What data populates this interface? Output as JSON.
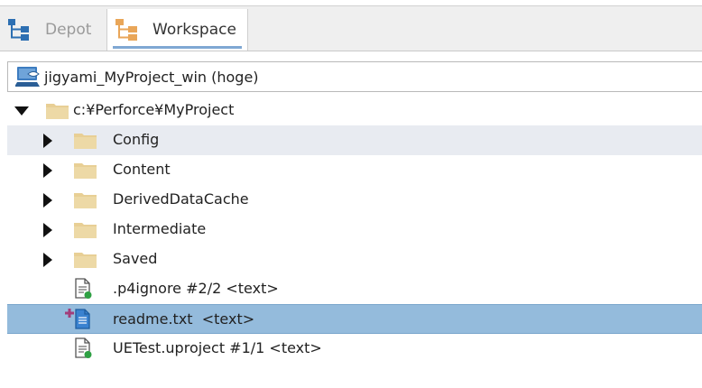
{
  "tabs": {
    "depot": "Depot",
    "workspace": "Workspace"
  },
  "workspace_selector": {
    "value": "jigyami_MyProject_win (hoge)"
  },
  "tree": {
    "root": "c:¥Perforce¥MyProject",
    "folders": [
      {
        "label": "Config"
      },
      {
        "label": "Content"
      },
      {
        "label": "DerivedDataCache"
      },
      {
        "label": "Intermediate"
      },
      {
        "label": "Saved"
      }
    ],
    "files": [
      {
        "label": ".p4ignore #2/2 <text>",
        "status": "synced"
      },
      {
        "label": "readme.txt  <text>",
        "status": "marked-for-add"
      },
      {
        "label": "UETest.uproject #1/1 <text>",
        "status": "synced"
      }
    ]
  },
  "colors": {
    "selection": "#94bbdc",
    "hover": "#e8ebf1",
    "folder": "#e8cf95",
    "tab_accent": "#7fa8d3"
  }
}
